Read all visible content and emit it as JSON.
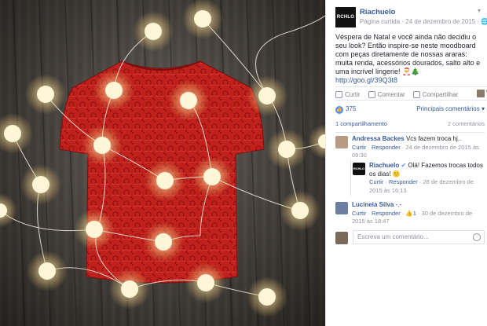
{
  "post": {
    "page_logo_text": "RCHLO",
    "page_name": "Riachuelo",
    "meta": "Página curtida · 24 de dezembro de 2015 · ",
    "caption": "Véspera de Natal e você ainda não decidiu o seu look? Então inspire-se neste moodboard com peças diretamente de nossas araras: muita renda, acessórios dourados, salto alto e uma incrível lingerie! 🎅🎄 ",
    "caption_link": "http://goo.gl/39Q3t8"
  },
  "actions": {
    "like": "Curtir",
    "comment": "Comentar",
    "share": "Compartilhar"
  },
  "stats": {
    "likes_count": "375",
    "top_comments": "Principais comentários ▾",
    "shares": "1 compartilhamento",
    "comments_count": "2 comentários"
  },
  "comments": [
    {
      "name": "Andressa Backes",
      "text": "Vcs fazem troca hj..",
      "like": "Curtir",
      "reply": "Responder",
      "time": "24 de dezembro de 2015 às 09:30",
      "avatar_color": "#b89a84"
    },
    {
      "name": "Riachuelo",
      "text": "Olá! Fazemos trocas todos os dias! 🙂",
      "like": "Curtir",
      "reply": "Responder",
      "time": "28 de dezembro de 2015 às 16:13",
      "avatar_text": "RCHLO",
      "is_reply": true
    },
    {
      "name": "Lucineia Silva",
      "text": "-.-",
      "like": "Curtir",
      "reply": "Responder",
      "like_count": "1",
      "time": "30 de dezembro de 2015 às 18:47",
      "avatar_color": "#6d7fa0"
    }
  ],
  "composer": {
    "placeholder": "Escreva um comentário..."
  },
  "colors": {
    "accent": "#365899",
    "shirt": "#c8201c",
    "bulb": "#fff6d8"
  }
}
